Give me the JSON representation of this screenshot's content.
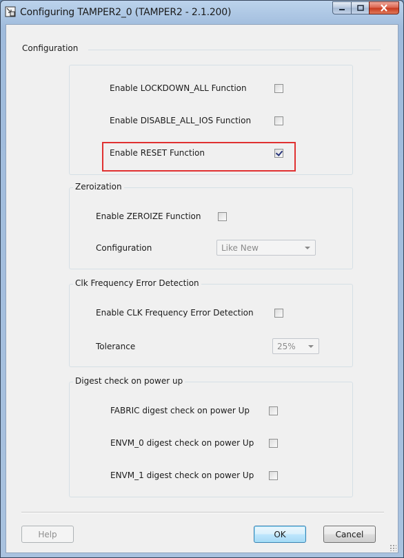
{
  "window": {
    "title": "Configuring TAMPER2_0 (TAMPER2 - 2.1.200)"
  },
  "configuration": {
    "legend": "Configuration",
    "options": [
      {
        "label": "Enable LOCKDOWN_ALL Function",
        "checked": false
      },
      {
        "label": "Enable DISABLE_ALL_IOS Function",
        "checked": false
      },
      {
        "label": "Enable RESET Function",
        "checked": true
      }
    ]
  },
  "zeroization": {
    "title": "Zeroization",
    "enable_label": "Enable ZEROIZE Function",
    "enable_checked": false,
    "config_label": "Configuration",
    "config_value": "Like New"
  },
  "clk": {
    "title": "Clk Frequency Error Detection",
    "enable_label": "Enable CLK Frequency Error Detection",
    "enable_checked": false,
    "tolerance_label": "Tolerance",
    "tolerance_value": "25%"
  },
  "digest": {
    "title": "Digest check on power up",
    "options": [
      {
        "label": "FABRIC digest check on power Up",
        "checked": false
      },
      {
        "label": "ENVM_0 digest check on power Up",
        "checked": false
      },
      {
        "label": "ENVM_1 digest check on power Up",
        "checked": false
      }
    ]
  },
  "buttons": {
    "help": "Help",
    "ok": "OK",
    "cancel": "Cancel"
  },
  "colors": {
    "highlight": "#e03030",
    "title_bar": "#a9c2df",
    "close_button": "#c7381d"
  }
}
